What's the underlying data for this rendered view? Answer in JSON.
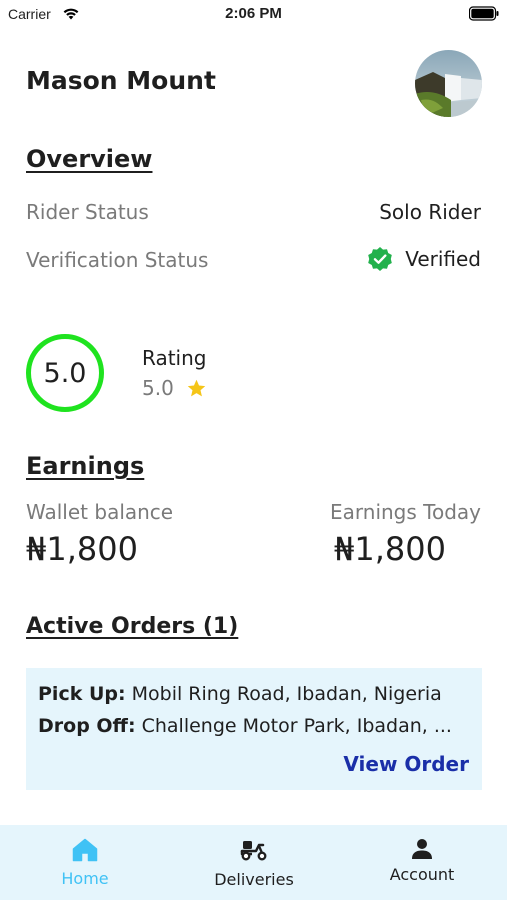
{
  "status_bar": {
    "carrier": "Carrier",
    "time": "2:06 PM"
  },
  "header": {
    "user_name": "Mason Mount"
  },
  "overview": {
    "title": "Overview",
    "rider_status_label": "Rider Status",
    "rider_status_value": "Solo Rider",
    "verification_label": "Verification Status",
    "verification_value": "Verified"
  },
  "rating": {
    "score": "5.0",
    "label": "Rating",
    "value": "5.0",
    "star_icon": "star-icon"
  },
  "earnings": {
    "title": "Earnings",
    "wallet_label": "Wallet balance",
    "wallet_value": "₦1,800",
    "today_label": "Earnings Today",
    "today_value": "₦1,800"
  },
  "active_orders": {
    "title": "Active Orders (1)",
    "pickup_label": "Pick Up:",
    "pickup_value": "Mobil Ring Road, Ibadan, Nigeria",
    "dropoff_label": "Drop Off:",
    "dropoff_value": "Challenge Motor Park, Ibadan, ...",
    "view_order": "View Order"
  },
  "tabs": [
    {
      "label": "Home",
      "icon": "home-icon",
      "active": true
    },
    {
      "label": "Deliveries",
      "icon": "scooter-icon",
      "active": false
    },
    {
      "label": "Account",
      "icon": "person-icon",
      "active": false
    }
  ],
  "colors": {
    "accent_blue": "#40c2f5",
    "link_blue": "#1a2fa8",
    "rating_green": "#1fe31f",
    "verified_green": "#22b14c",
    "star_yellow": "#f5c518",
    "card_bg": "#e5f5fc"
  }
}
